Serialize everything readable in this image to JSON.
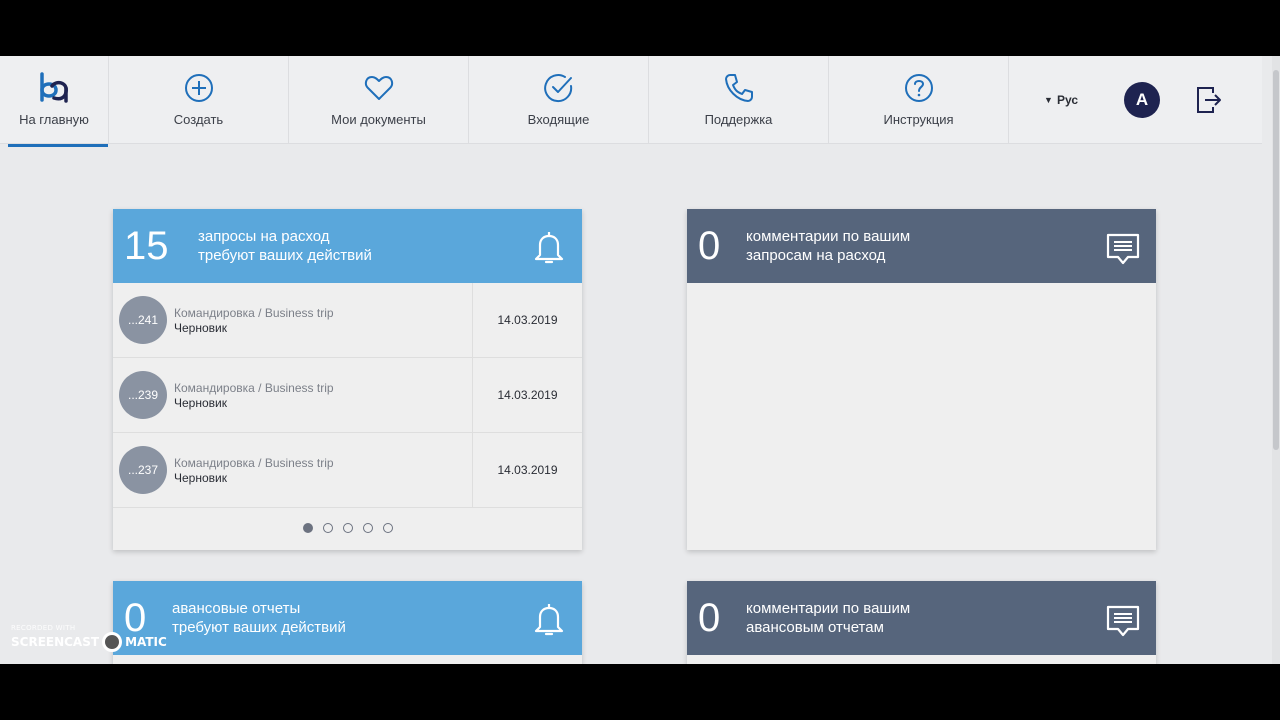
{
  "nav": {
    "home_label": "На главную",
    "create_label": "Создать",
    "docs_label": "Мои документы",
    "inbox_label": "Входящие",
    "support_label": "Поддержка",
    "help_label": "Инструкция",
    "language": "Рус",
    "avatar_letter": "A"
  },
  "cards": {
    "expense_requests": {
      "count": "15",
      "line1": "запросы на расход",
      "line2": "требуют ваших действий",
      "icon": "bell-icon",
      "rows": [
        {
          "id": "...241",
          "type": "Командировка / Business trip",
          "status": "Черновик",
          "date": "14.03.2019"
        },
        {
          "id": "...239",
          "type": "Командировка / Business trip",
          "status": "Черновик",
          "date": "14.03.2019"
        },
        {
          "id": "...237",
          "type": "Командировка / Business trip",
          "status": "Черновик",
          "date": "14.03.2019"
        }
      ],
      "pages": 5,
      "current_page": 1
    },
    "expense_comments": {
      "count": "0",
      "line1": "комментарии по вашим",
      "line2": "запросам на расход",
      "icon": "comment-icon"
    },
    "advance_reports": {
      "count": "0",
      "line1": "авансовые отчеты",
      "line2": "требуют ваших действий",
      "icon": "bell-icon"
    },
    "advance_comments": {
      "count": "0",
      "line1": "комментарии по вашим",
      "line2": "авансовым отчетам",
      "icon": "comment-icon"
    }
  },
  "watermark": {
    "small": "RECORDED WITH",
    "left": "SCREENCAST",
    "right": "MATIC"
  },
  "colors": {
    "blue_header": "#5aa7db",
    "slate_header": "#56657c",
    "accent": "#1f6fba",
    "avatar": "#1e2350"
  }
}
